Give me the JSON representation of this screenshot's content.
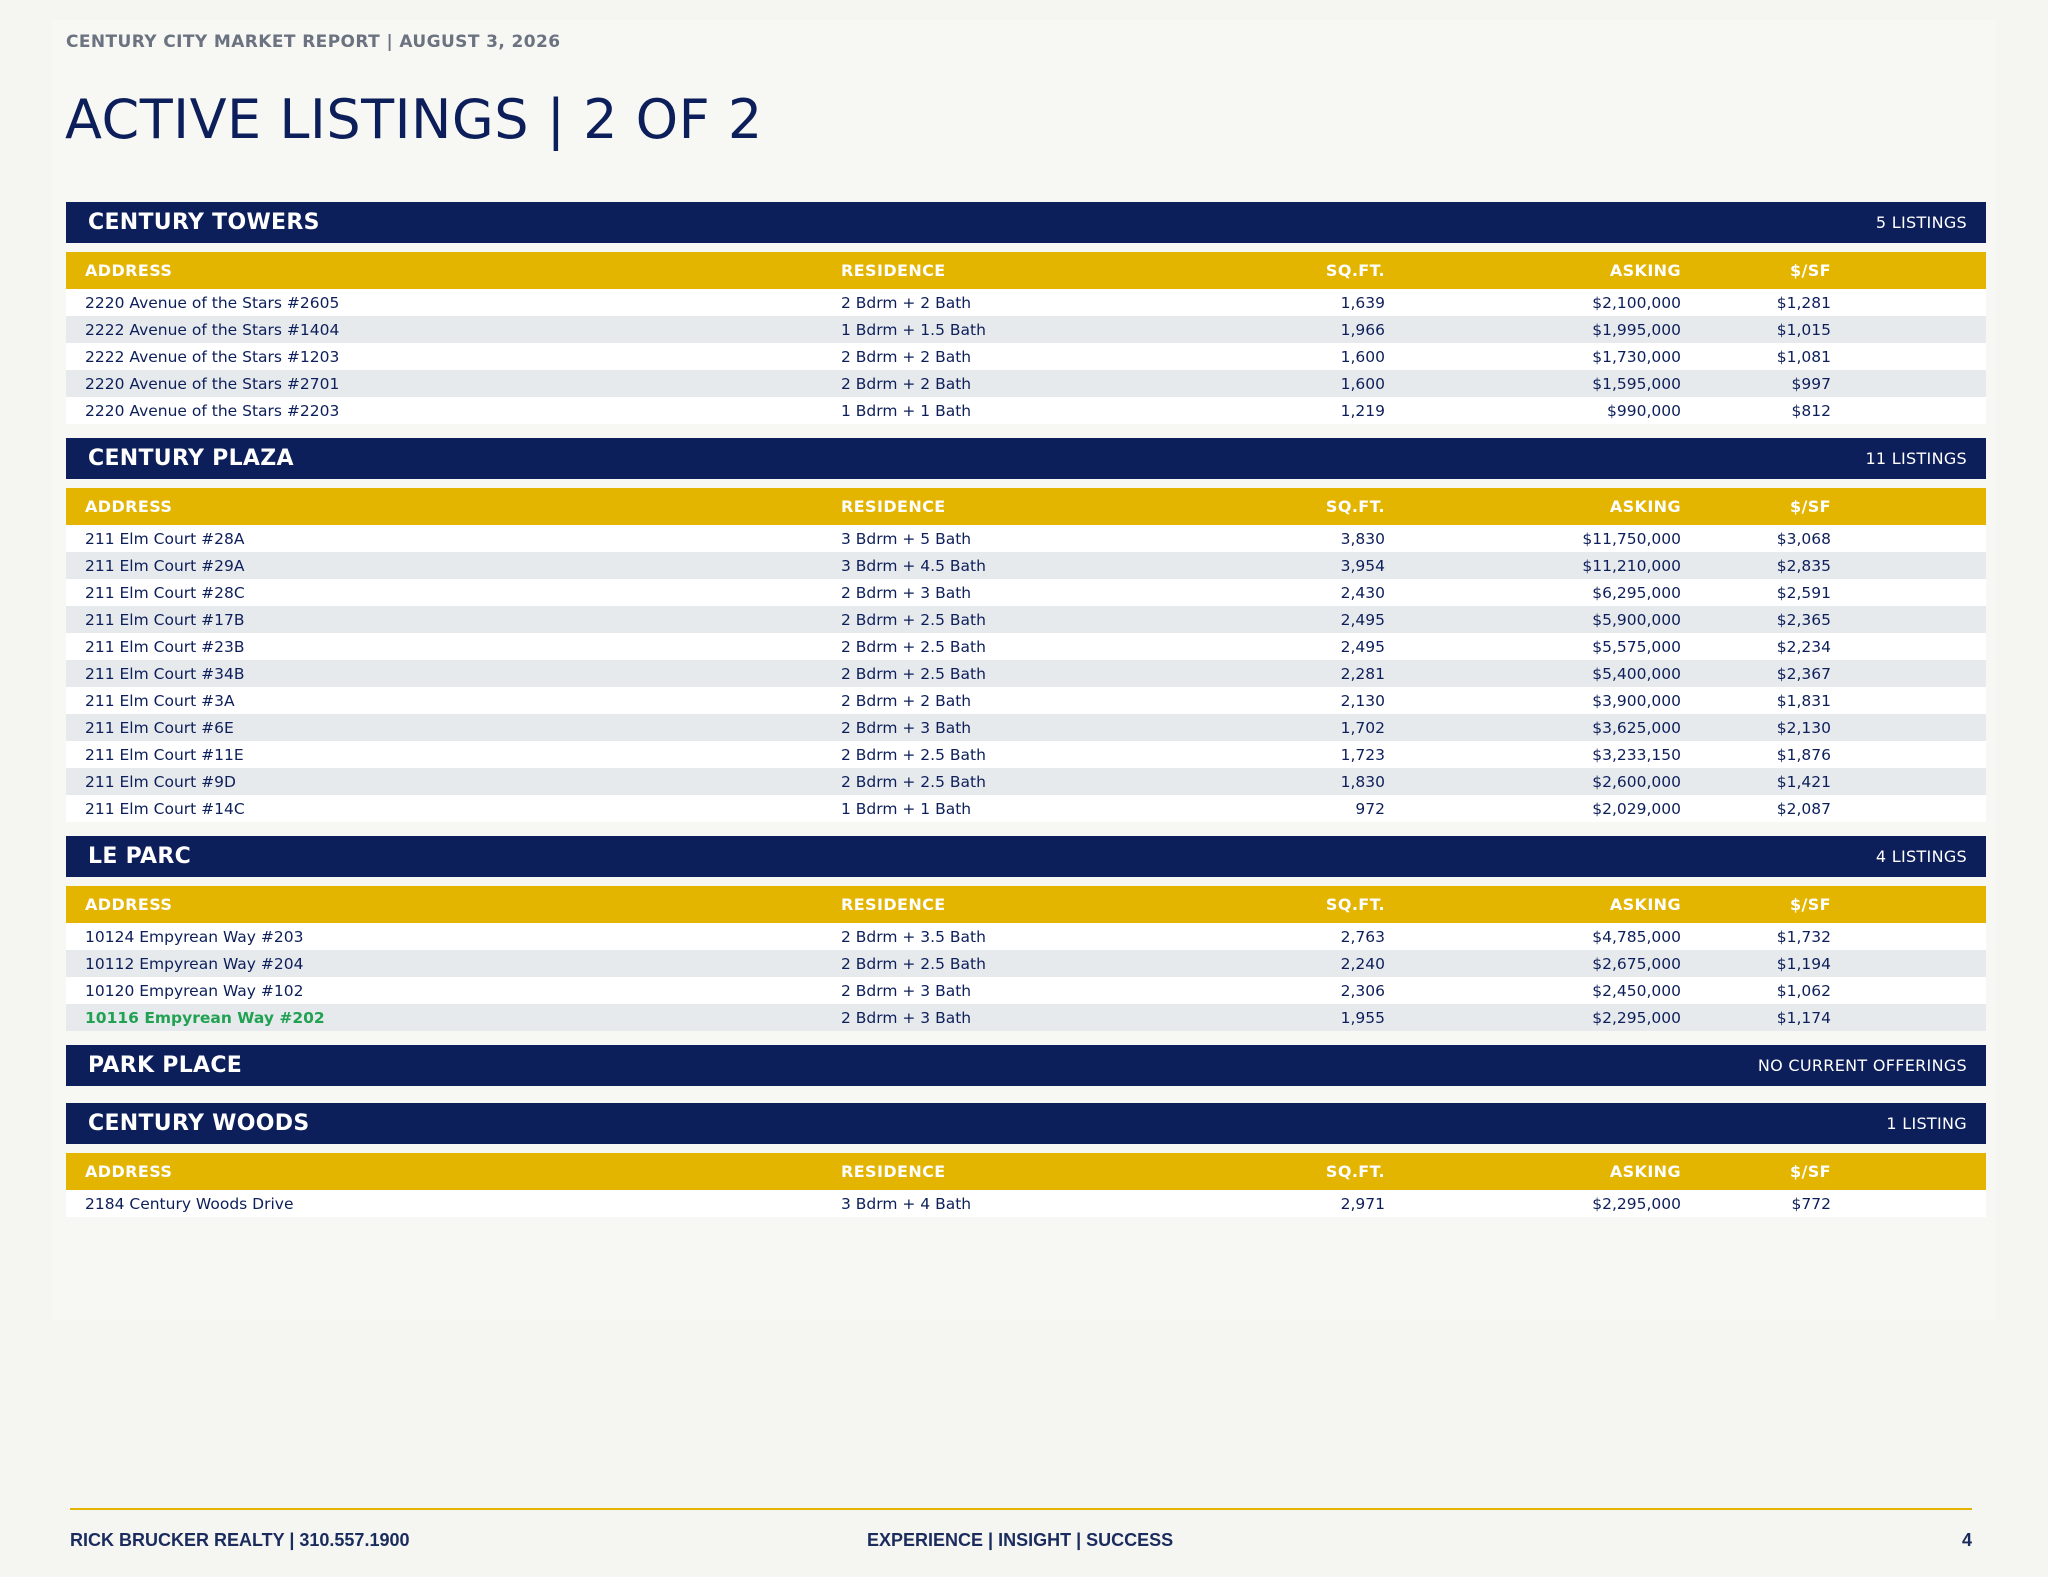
{
  "header": {
    "report_label": "CENTURY CITY MARKET REPORT | AUGUST 3, 2026",
    "title": "ACTIVE LISTINGS | 2 OF 2"
  },
  "columns": {
    "address": "ADDRESS",
    "residence": "RESIDENCE",
    "sqft": "SQ.FT.",
    "asking": "ASKING",
    "psf": "$/SF"
  },
  "buildings": [
    {
      "name": "CENTURY TOWERS",
      "count_label": "5 LISTINGS",
      "listings": [
        {
          "address": "2220 Avenue of the Stars #2605",
          "residence": "2 Bdrm + 2 Bath",
          "sqft": "1,639",
          "asking": "$2,100,000",
          "psf": "$1,281"
        },
        {
          "address": "2222 Avenue of the Stars #1404",
          "residence": "1 Bdrm + 1.5 Bath",
          "sqft": "1,966",
          "asking": "$1,995,000",
          "psf": "$1,015"
        },
        {
          "address": "2222 Avenue of the Stars #1203",
          "residence": "2 Bdrm + 2 Bath",
          "sqft": "1,600",
          "asking": "$1,730,000",
          "psf": "$1,081"
        },
        {
          "address": "2220 Avenue of the Stars #2701",
          "residence": "2 Bdrm + 2 Bath",
          "sqft": "1,600",
          "asking": "$1,595,000",
          "psf": "$997"
        },
        {
          "address": "2220 Avenue of the Stars #2203",
          "residence": "1 Bdrm + 1 Bath",
          "sqft": "1,219",
          "asking": "$990,000",
          "psf": "$812"
        }
      ]
    },
    {
      "name": "CENTURY PLAZA",
      "count_label": "11 LISTINGS",
      "listings": [
        {
          "address": "211 Elm Court #28A",
          "residence": "3 Bdrm + 5 Bath",
          "sqft": "3,830",
          "asking": "$11,750,000",
          "psf": "$3,068"
        },
        {
          "address": "211 Elm Court #29A",
          "residence": "3 Bdrm + 4.5 Bath",
          "sqft": "3,954",
          "asking": "$11,210,000",
          "psf": "$2,835"
        },
        {
          "address": "211 Elm Court #28C",
          "residence": "2 Bdrm + 3 Bath",
          "sqft": "2,430",
          "asking": "$6,295,000",
          "psf": "$2,591"
        },
        {
          "address": "211 Elm Court #17B",
          "residence": "2 Bdrm + 2.5 Bath",
          "sqft": "2,495",
          "asking": "$5,900,000",
          "psf": "$2,365"
        },
        {
          "address": "211 Elm Court #23B",
          "residence": "2 Bdrm + 2.5 Bath",
          "sqft": "2,495",
          "asking": "$5,575,000",
          "psf": "$2,234"
        },
        {
          "address": "211 Elm Court #34B",
          "residence": "2 Bdrm + 2.5 Bath",
          "sqft": "2,281",
          "asking": "$5,400,000",
          "psf": "$2,367"
        },
        {
          "address": "211 Elm Court #3A",
          "residence": "2 Bdrm + 2 Bath",
          "sqft": "2,130",
          "asking": "$3,900,000",
          "psf": "$1,831"
        },
        {
          "address": "211 Elm Court #6E",
          "residence": "2 Bdrm + 3 Bath",
          "sqft": "1,702",
          "asking": "$3,625,000",
          "psf": "$2,130"
        },
        {
          "address": "211 Elm Court #11E",
          "residence": "2 Bdrm + 2.5 Bath",
          "sqft": "1,723",
          "asking": "$3,233,150",
          "psf": "$1,876"
        },
        {
          "address": "211 Elm Court #9D",
          "residence": "2 Bdrm + 2.5 Bath",
          "sqft": "1,830",
          "asking": "$2,600,000",
          "psf": "$1,421"
        },
        {
          "address": "211 Elm Court #14C",
          "residence": "1 Bdrm + 1 Bath",
          "sqft": "972",
          "asking": "$2,029,000",
          "psf": "$2,087"
        }
      ]
    },
    {
      "name": "LE PARC",
      "count_label": "4 LISTINGS",
      "listings": [
        {
          "address": "10124 Empyrean Way #203",
          "residence": "2 Bdrm + 3.5 Bath",
          "sqft": "2,763",
          "asking": "$4,785,000",
          "psf": "$1,732"
        },
        {
          "address": "10112 Empyrean Way #204",
          "residence": "2 Bdrm + 2.5 Bath",
          "sqft": "2,240",
          "asking": "$2,675,000",
          "psf": "$1,194"
        },
        {
          "address": "10120 Empyrean Way #102",
          "residence": "2 Bdrm + 3 Bath",
          "sqft": "2,306",
          "asking": "$2,450,000",
          "psf": "$1,062"
        },
        {
          "address": "10116 Empyrean Way #202",
          "residence": "2 Bdrm + 3 Bath",
          "sqft": "1,955",
          "asking": "$2,295,000",
          "psf": "$1,174",
          "highlight": true
        }
      ]
    },
    {
      "name": "PARK PLACE",
      "count_label": "NO CURRENT OFFERINGS",
      "listings": []
    },
    {
      "name": "CENTURY WOODS",
      "count_label": "1 LISTING",
      "listings": [
        {
          "address": "2184 Century Woods Drive",
          "residence": "3 Bdrm + 4 Bath",
          "sqft": "2,971",
          "asking": "$2,295,000",
          "psf": "$772"
        }
      ]
    }
  ],
  "footer": {
    "left": "RICK BRUCKER REALTY | 310.557.1900",
    "center": "EXPERIENCE | INSIGHT | SUCCESS",
    "page_number": "4"
  },
  "colors": {
    "navy": "#0d1f5a",
    "gold": "#e3b400",
    "highlight_green": "#21a152",
    "row_stripe": "#e7eaed"
  }
}
